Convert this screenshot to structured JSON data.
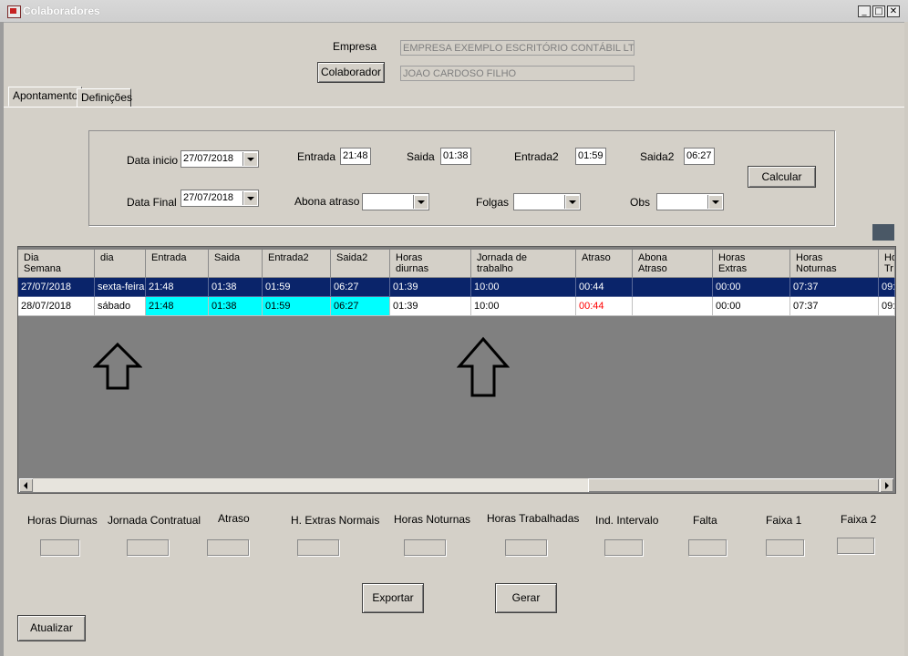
{
  "window": {
    "title": "Colaboradores"
  },
  "header": {
    "empresa_label": "Empresa",
    "empresa_value": "EMPRESA EXEMPLO ESCRITÓRIO CONTÁBIL LTD",
    "colaborador_button": "Colaborador",
    "colaborador_value": "JOAO CARDOSO FILHO"
  },
  "tabs": [
    {
      "label": "Apontamento",
      "active": true
    },
    {
      "label": "Definições",
      "active": false
    }
  ],
  "filters": {
    "data_inicio_label": "Data inicio",
    "data_inicio_value": "27/07/2018",
    "data_final_label": "Data Final",
    "data_final_value": "27/07/2018",
    "entrada_label": "Entrada",
    "entrada_value": "21:48",
    "saida_label": "Saida",
    "saida_value": "01:38",
    "entrada2_label": "Entrada2",
    "entrada2_value": "01:59",
    "saida2_label": "Saida2",
    "saida2_value": "06:27",
    "calcular_button": "Calcular",
    "abona_atraso_label": "Abona atraso",
    "abona_atraso_value": "",
    "folgas_label": "Folgas",
    "folgas_value": "",
    "obs_label": "Obs",
    "obs_value": ""
  },
  "grid": {
    "columns": [
      {
        "label": "Dia\nSemana"
      },
      {
        "label": "dia"
      },
      {
        "label": "Entrada"
      },
      {
        "label": "Saida"
      },
      {
        "label": "Entrada2"
      },
      {
        "label": "Saida2"
      },
      {
        "label": "Horas\ndiurnas"
      },
      {
        "label": "Jornada de\ntrabalho"
      },
      {
        "label": "Atraso"
      },
      {
        "label": "Abona\nAtraso"
      },
      {
        "label": "Horas\nExtras"
      },
      {
        "label": "Horas\nNoturnas"
      },
      {
        "label": "Ho\nTr"
      }
    ],
    "rows": [
      {
        "cells": [
          "27/07/2018",
          "sexta-feira",
          "21:48",
          "01:38",
          "01:59",
          "06:27",
          "01:39",
          "10:00",
          "00:44",
          "",
          "00:00",
          "07:37",
          "09:"
        ]
      },
      {
        "cells": [
          "28/07/2018",
          "sábado",
          "21:48",
          "01:38",
          "01:59",
          "06:27",
          "01:39",
          "10:00",
          "00:44",
          "",
          "00:00",
          "07:37",
          "09:"
        ]
      }
    ],
    "selected_row": 0
  },
  "summary": {
    "labels": [
      "Horas Diurnas",
      "Jornada Contratual",
      "Atraso",
      "H. Extras Normais",
      "Horas Noturnas",
      "Horas Trabalhadas",
      "Ind. Intervalo",
      "Falta",
      "Faixa 1",
      "Faixa 2"
    ]
  },
  "buttons": {
    "exportar": "Exportar",
    "gerar": "Gerar",
    "atualizar": "Atualizar"
  },
  "colors": {
    "selection": "#0a246a",
    "highlight_cyan": "#00ffff",
    "atraso_red": "#ff0000",
    "grid_bg": "#808080"
  }
}
